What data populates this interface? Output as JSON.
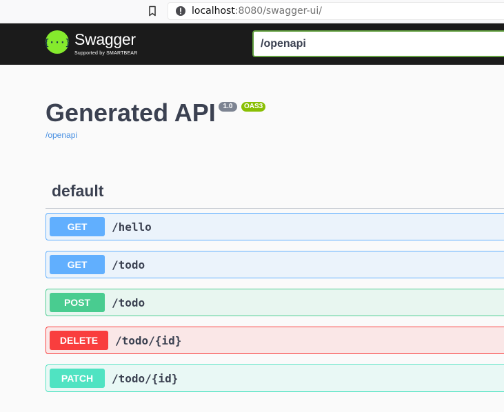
{
  "browser": {
    "url_host": "localhost",
    "url_rest": ":8080/swagger-ui/"
  },
  "topbar": {
    "logo_name": "Swagger",
    "logo_tagline": "Supported by SMARTBEAR",
    "spec_url_value": "/openapi"
  },
  "info": {
    "title": "Generated API",
    "version": "1.0",
    "oas_badge": "OAS3",
    "spec_link": "/openapi"
  },
  "tag": {
    "name": "default"
  },
  "operations": [
    {
      "method": "GET",
      "path": "/hello"
    },
    {
      "method": "GET",
      "path": "/todo"
    },
    {
      "method": "POST",
      "path": "/todo"
    },
    {
      "method": "DELETE",
      "path": "/todo/{id}"
    },
    {
      "method": "PATCH",
      "path": "/todo/{id}"
    }
  ],
  "colors": {
    "topbar_bg": "#1b1b1b",
    "logo_green": "#85ea2d",
    "get": "#61affe",
    "post": "#49cc90",
    "delete": "#f93e3e",
    "patch": "#50e3c2",
    "text": "#3b4151"
  },
  "icons": {
    "bookmark": "bookmark-icon",
    "site_info": "info-icon",
    "logo": "swagger-logo-icon"
  }
}
